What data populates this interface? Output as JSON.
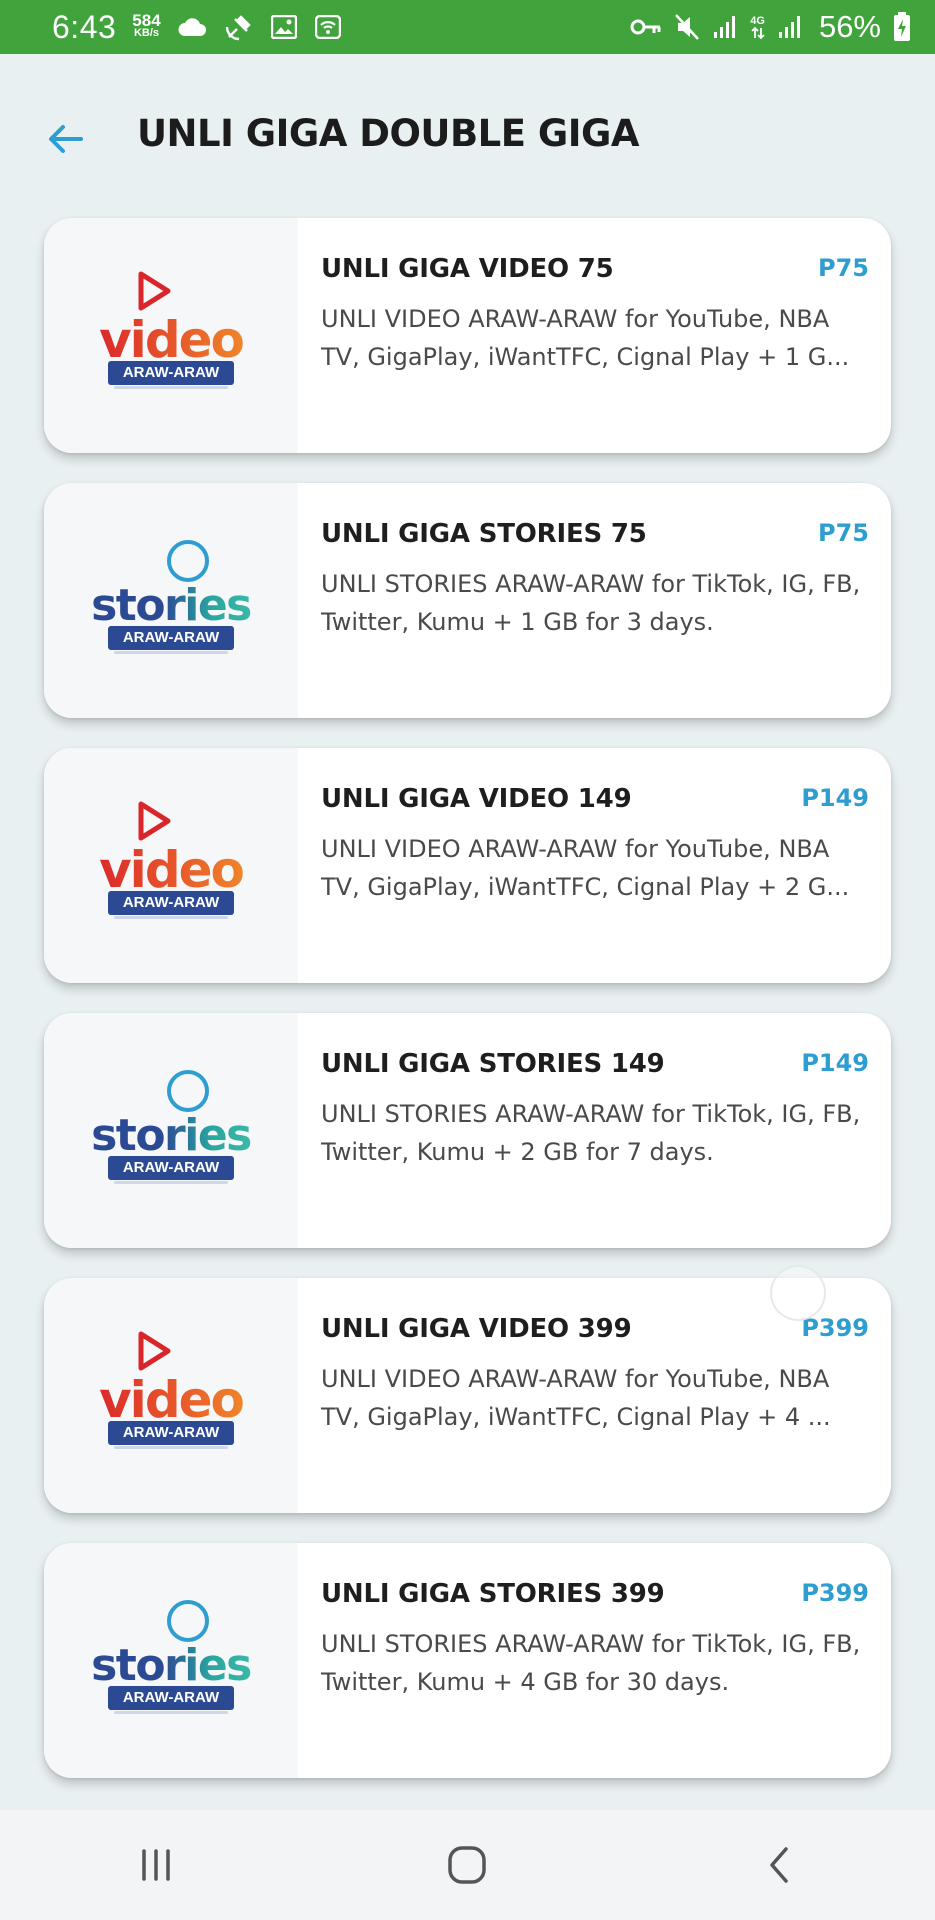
{
  "status_bar": {
    "time": "6:43",
    "speed_value": "584",
    "speed_unit": "KB/s",
    "network_type": "4G",
    "battery_percent": "56%",
    "background_color": "#41a33b",
    "left_icons": [
      "cloud-icon",
      "satellite-icon",
      "gallery-icon",
      "wifi-calling-icon"
    ],
    "right_icons": [
      "vpn-key-icon",
      "mute-icon",
      "signal-icon",
      "4g-signal-icon",
      "battery-icon"
    ]
  },
  "header": {
    "title": "UNLI GIGA DOUBLE GIGA",
    "back_icon": "arrow-left-icon",
    "accent_color": "#2e9ed1"
  },
  "promos": [
    {
      "logo": "video",
      "logo_word": "video",
      "logo_badge": "ARAW-ARAW",
      "title": "UNLI GIGA VIDEO 75",
      "price": "P75",
      "description": "UNLI VIDEO ARAW-ARAW for YouTube, NBA TV, GigaPlay, iWantTFC, Cignal Play + 1 G..."
    },
    {
      "logo": "stories",
      "logo_word": "stories",
      "logo_badge": "ARAW-ARAW",
      "title": "UNLI GIGA STORIES 75",
      "price": "P75",
      "description": "UNLI STORIES ARAW-ARAW for TikTok, IG, FB, Twitter, Kumu + 1 GB for 3 days."
    },
    {
      "logo": "video",
      "logo_word": "video",
      "logo_badge": "ARAW-ARAW",
      "title": "UNLI GIGA VIDEO 149",
      "price": "P149",
      "description": "UNLI VIDEO ARAW-ARAW for YouTube, NBA TV, GigaPlay, iWantTFC, Cignal Play + 2 G..."
    },
    {
      "logo": "stories",
      "logo_word": "stories",
      "logo_badge": "ARAW-ARAW",
      "title": "UNLI GIGA STORIES 149",
      "price": "P149",
      "description": "UNLI STORIES ARAW-ARAW for TikTok, IG, FB, Twitter, Kumu + 2 GB for 7 days."
    },
    {
      "logo": "video",
      "logo_word": "video",
      "logo_badge": "ARAW-ARAW",
      "title": "UNLI GIGA VIDEO 399",
      "price": "P399",
      "description": "UNLI VIDEO ARAW-ARAW for YouTube, NBA TV, GigaPlay, iWantTFC, Cignal Play + 4 ..."
    },
    {
      "logo": "stories",
      "logo_word": "stories",
      "logo_badge": "ARAW-ARAW",
      "title": "UNLI GIGA STORIES 399",
      "price": "P399",
      "description": "UNLI STORIES ARAW-ARAW for TikTok, IG, FB, Twitter, Kumu + 4 GB for 30 days."
    }
  ],
  "nav_bar": {
    "buttons": [
      "recent-apps-icon",
      "home-icon",
      "back-icon"
    ]
  }
}
